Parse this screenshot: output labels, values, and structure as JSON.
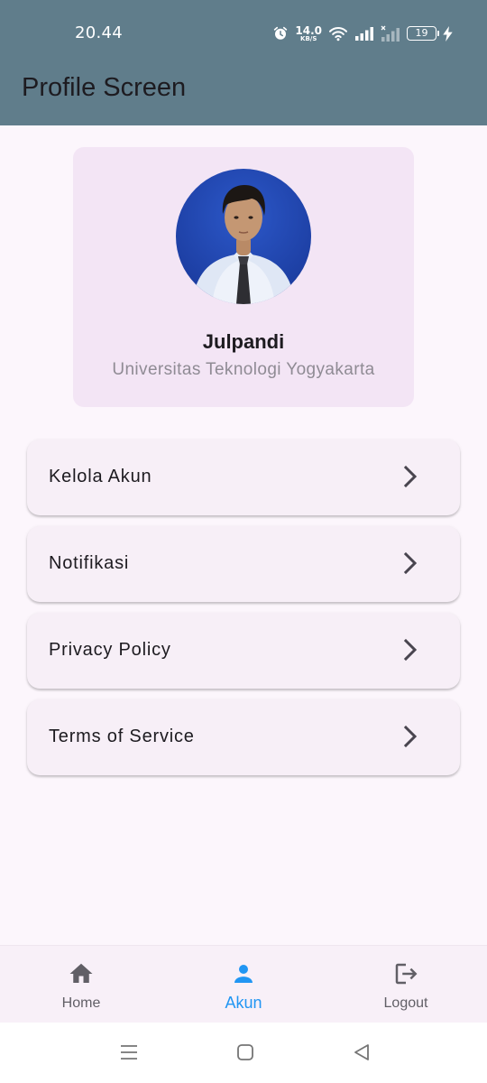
{
  "status_bar": {
    "time": "20.44",
    "net_speed_value": "14.0",
    "net_speed_unit": "KB/S",
    "battery_level": "19",
    "icons": [
      "alarm-icon",
      "wifi-icon",
      "signal-icon",
      "signal-no-service-icon",
      "battery-icon",
      "charging-icon"
    ]
  },
  "app_bar": {
    "title": "Profile Screen"
  },
  "profile": {
    "name": "Julpandi",
    "university": "Universitas Teknologi Yogyakarta"
  },
  "menu": {
    "items": [
      {
        "label": "Kelola Akun",
        "icon": "chevron-right-icon"
      },
      {
        "label": "Notifikasi",
        "icon": "chevron-right-icon"
      },
      {
        "label": "Privacy Policy",
        "icon": "chevron-right-icon"
      },
      {
        "label": "Terms of Service",
        "icon": "chevron-right-icon"
      }
    ]
  },
  "bottom_nav": {
    "items": [
      {
        "label": "Home",
        "icon": "home-icon",
        "active": false
      },
      {
        "label": "Akun",
        "icon": "person-icon",
        "active": true
      },
      {
        "label": "Logout",
        "icon": "logout-icon",
        "active": false
      }
    ]
  },
  "colors": {
    "app_bar": "#607d8b",
    "background": "#fcf6fc",
    "profile_card": "#f3e5f5",
    "menu_card": "#f7eff7",
    "active_nav": "#2196f3",
    "inactive_nav": "#615f66"
  },
  "system_nav": {
    "icons": [
      "recent-apps-icon",
      "home-square-icon",
      "back-triangle-icon"
    ]
  }
}
